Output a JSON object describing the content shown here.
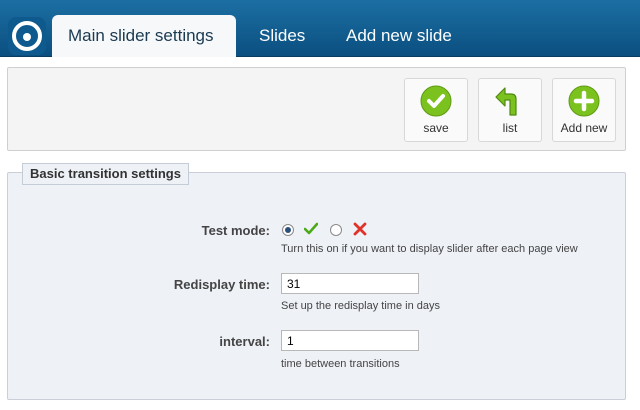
{
  "nav": {
    "logo": "app-logo",
    "tabs": [
      {
        "label": "Main slider settings",
        "active": true
      },
      {
        "label": "Slides",
        "active": false
      },
      {
        "label": "Add new slide",
        "active": false
      }
    ]
  },
  "toolbar": {
    "save_label": "save",
    "list_label": "list",
    "add_label": "Add new"
  },
  "panel": {
    "legend": "Basic transition settings",
    "test_mode": {
      "label": "Test mode:",
      "selected": "on",
      "help": "Turn this on if you want to display slider after each page view"
    },
    "redisplay_time": {
      "label": "Redisplay time:",
      "value": "31",
      "help": "Set up the redisplay time in days"
    },
    "interval": {
      "label": "interval:",
      "value": "1",
      "help": "time between transitions"
    }
  },
  "colors": {
    "nav_bg": "#0b4f80",
    "accent_green": "#7cc21f",
    "error_red": "#e0322a"
  }
}
